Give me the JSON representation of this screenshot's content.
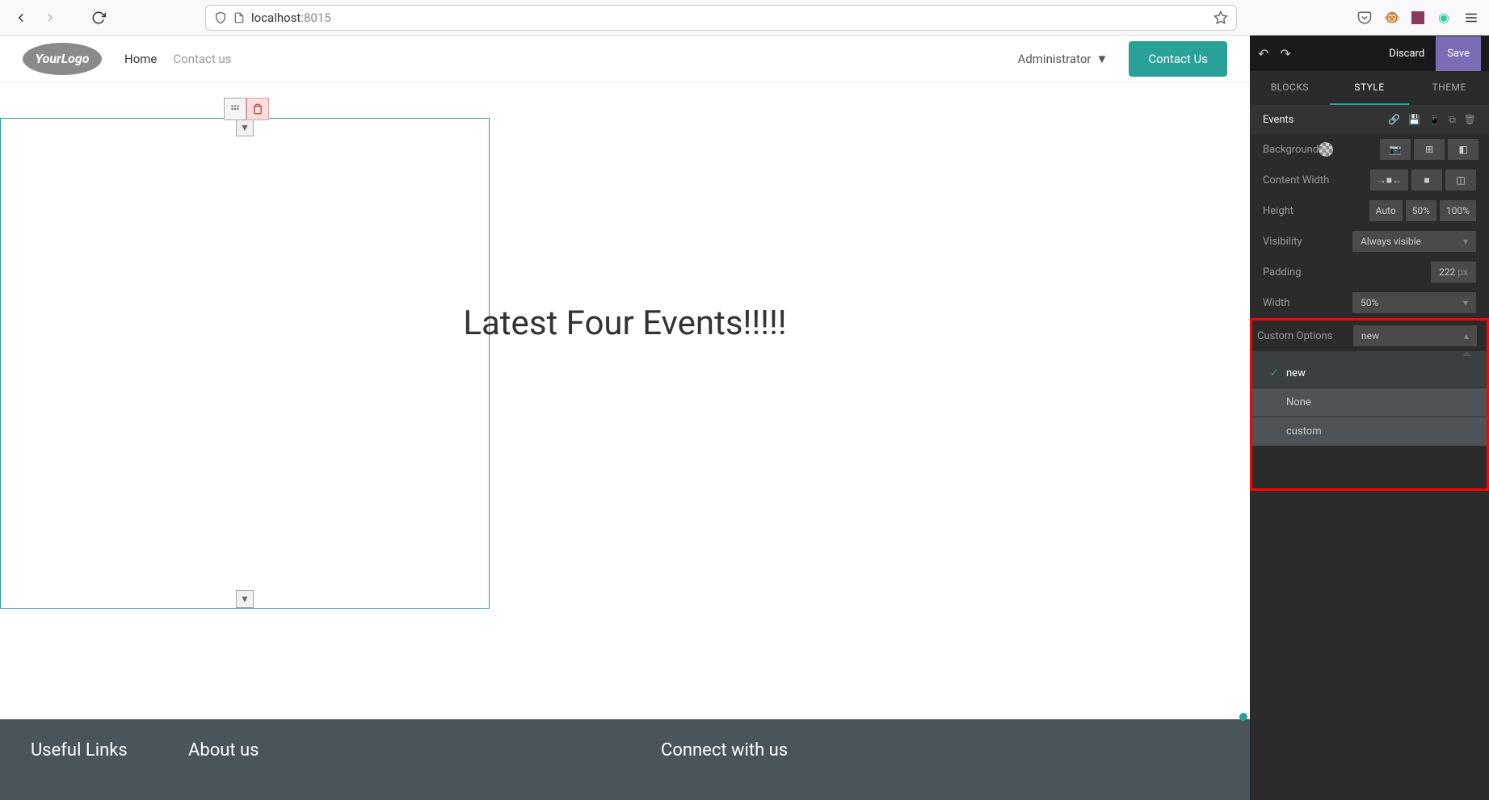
{
  "browser": {
    "url_host": "localhost",
    "url_port": ":8015"
  },
  "site": {
    "logo_text": "YourLogo",
    "nav": {
      "home": "Home",
      "contact": "Contact us"
    },
    "admin_label": "Administrator",
    "contact_btn": "Contact Us",
    "block_text": "Latest Four Events!!!!!",
    "footer": {
      "col1": "Useful Links",
      "col2": "About us",
      "col3": "Connect with us"
    }
  },
  "editor": {
    "discard": "Discard",
    "save": "Save",
    "tabs": {
      "blocks": "BLOCKS",
      "style": "STYLE",
      "theme": "THEME"
    },
    "section_title": "Events",
    "props": {
      "background": "Background",
      "content_width": "Content Width",
      "height": "Height",
      "visibility": "Visibility",
      "padding": "Padding",
      "width": "Width",
      "custom_options": "Custom Options"
    },
    "height_opts": {
      "auto": "Auto",
      "fifty": "50%",
      "hundred": "100%"
    },
    "visibility_value": "Always visible",
    "padding_value": "222",
    "padding_unit": "px",
    "width_value": "50%",
    "custom_value": "new",
    "custom_options_list": {
      "new": "new",
      "none": "None",
      "custom": "custom"
    }
  }
}
